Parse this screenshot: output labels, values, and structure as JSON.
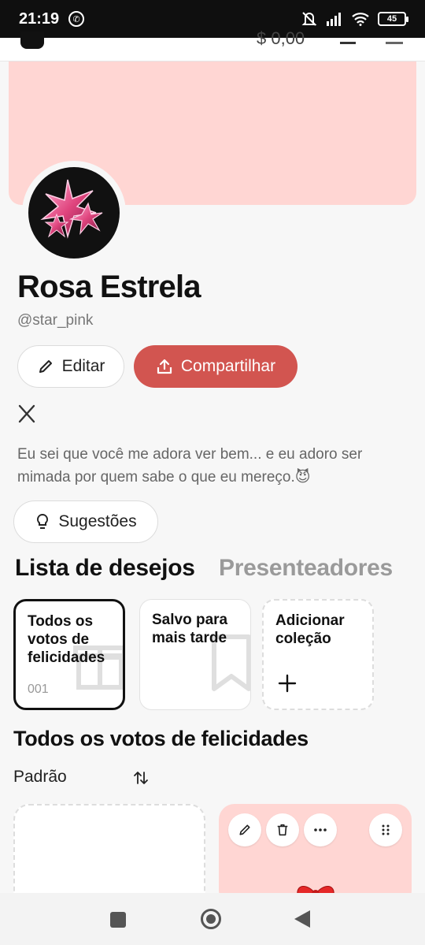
{
  "status_bar": {
    "time": "21:19",
    "battery": "45"
  },
  "header": {
    "balance": "$ 0,00"
  },
  "profile": {
    "name": "Rosa Estrela",
    "handle": "@star_pink",
    "bio": "Eu sei que você me adora ver bem... e eu adoro ser mimada por quem sabe o que eu mereço.😈"
  },
  "buttons": {
    "edit": "Editar",
    "share": "Compartilhar",
    "suggestions": "Sugestões"
  },
  "tabs": [
    {
      "label": "Lista de desejos"
    },
    {
      "label": "Presenteadores"
    }
  ],
  "collections": [
    {
      "title": "Todos os votos de felicidades",
      "count": "001"
    },
    {
      "title": "Salvo para mais tarde"
    },
    {
      "title": "Adicionar coleção"
    }
  ],
  "section": {
    "title": "Todos os votos de felicidades",
    "sort_label": "Padrão"
  },
  "colors": {
    "accent": "#d25550",
    "cover": "#ffd6d3"
  }
}
